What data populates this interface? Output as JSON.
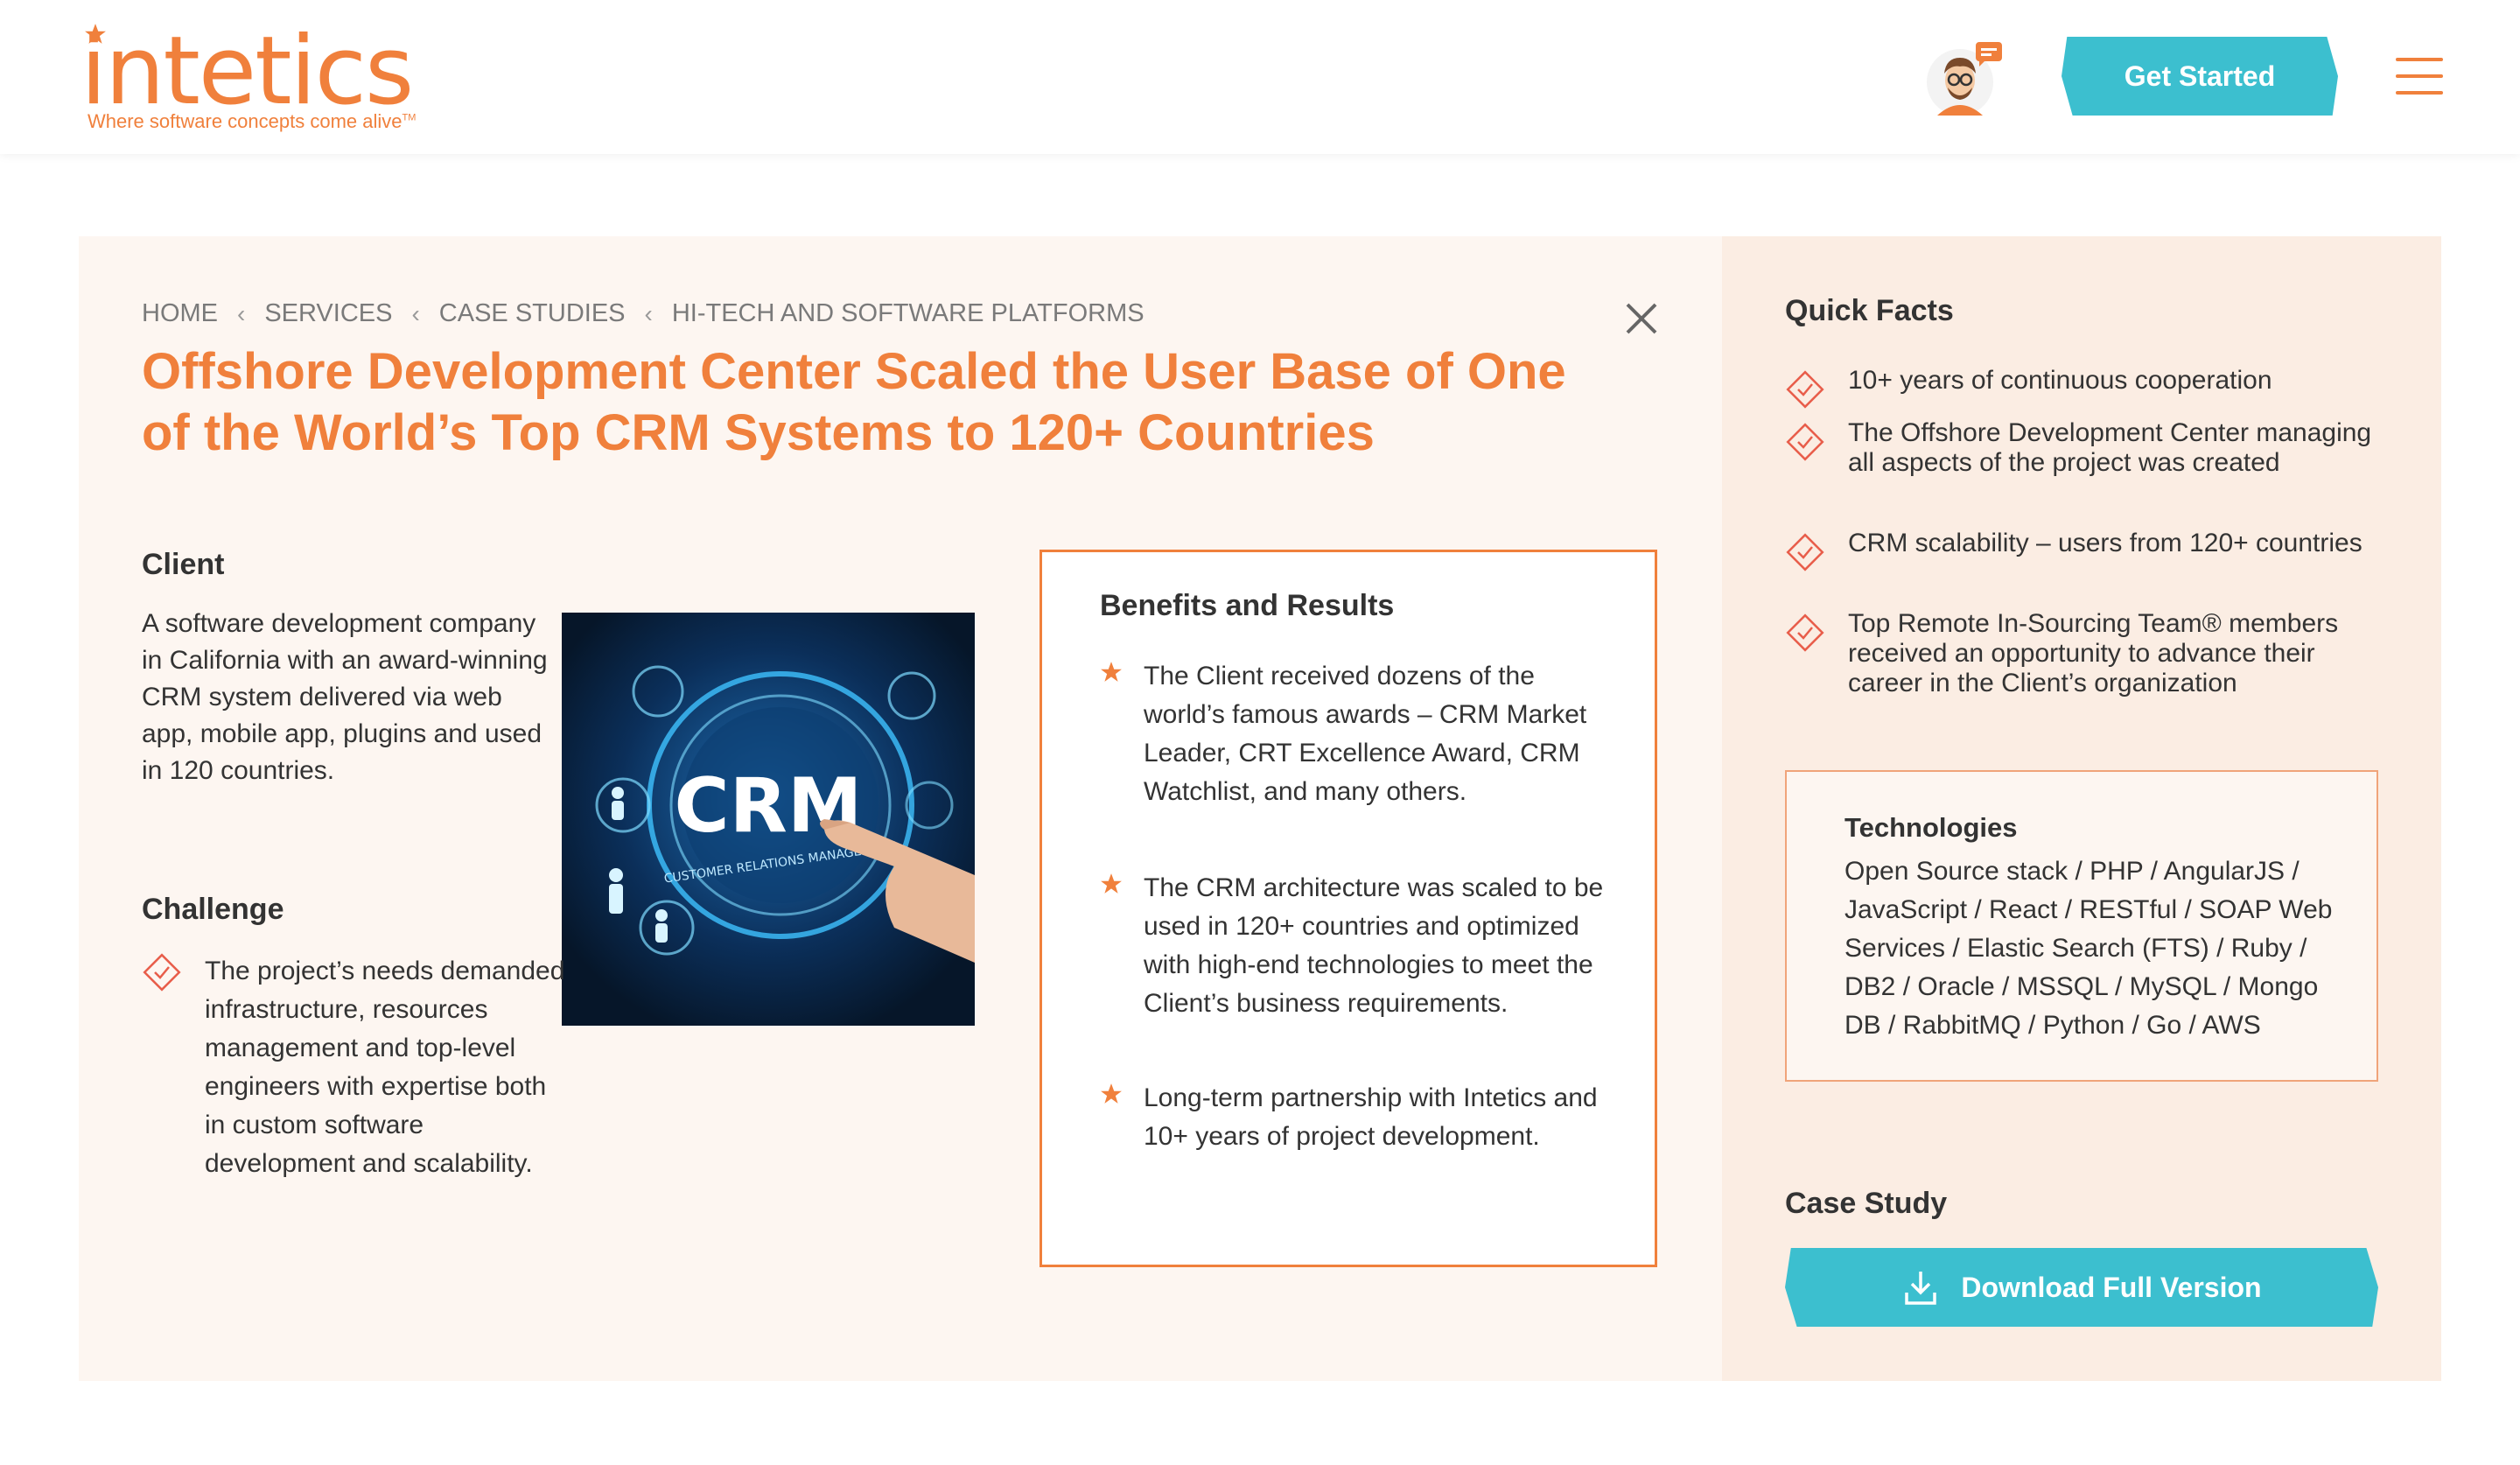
{
  "header": {
    "logo_text": "intetics",
    "logo_tagline": "Where software concepts come alive",
    "logo_tm": "TM",
    "cta_label": "Get Started"
  },
  "breadcrumb": [
    "HOME",
    "SERVICES",
    "CASE STUDIES",
    "HI-TECH AND SOFTWARE PLATFORMS"
  ],
  "title": "Offshore Development Center Scaled the User Base of One of the World’s Top CRM Systems to 120+ Countries",
  "client": {
    "heading": "Client",
    "text": "A software development company in California with an award-winning CRM system delivered via web app, mobile app, plugins and used in 120 countries."
  },
  "challenge": {
    "heading": "Challenge",
    "text": "The project’s needs demanded infrastructure, resources management and top-level engineers with expertise both in custom software development and scalability."
  },
  "benefits": {
    "heading": "Benefits and Results",
    "items": [
      "The Client received dozens of the world’s famous awards – CRM Market Leader, CRT Excellence Award, CRM Watchlist, and many others.",
      "The CRM architecture was scaled to be used in 120+ countries and optimized with high-end technologies to meet the Client’s business requirements.",
      "Long-term partnership with Intetics and 10+ years of project development."
    ]
  },
  "quick_facts": {
    "heading": "Quick Facts",
    "items": [
      "10+ years of continuous cooperation",
      "The Offshore Development Center managing all aspects of the project was created",
      "CRM scalability – users from 120+ countries",
      "Top Remote In-Sourcing Team® members received an opportunity to advance their career in the Client’s organization"
    ]
  },
  "technologies": {
    "heading": "Technologies",
    "text": "Open Source stack / PHP / AngularJS / JavaScript / React / RESTful / SOAP Web Services / Elastic Search (FTS) / Ruby / DB2 / Oracle / MSSQL / MySQL / Mongo DB / RabbitMQ / Python / Go / AWS"
  },
  "case_study": {
    "heading": "Case Study",
    "download_label": "Download Full Version"
  },
  "image": {
    "crm_text": "CRM",
    "crm_subtext": "CUSTOMER RELATIONS MANAGEMENT"
  },
  "colors": {
    "accent": "#f0803c",
    "button": "#3cbfcf",
    "card_bg": "#fdf6f1",
    "sidebar_bg": "#fbede3"
  }
}
